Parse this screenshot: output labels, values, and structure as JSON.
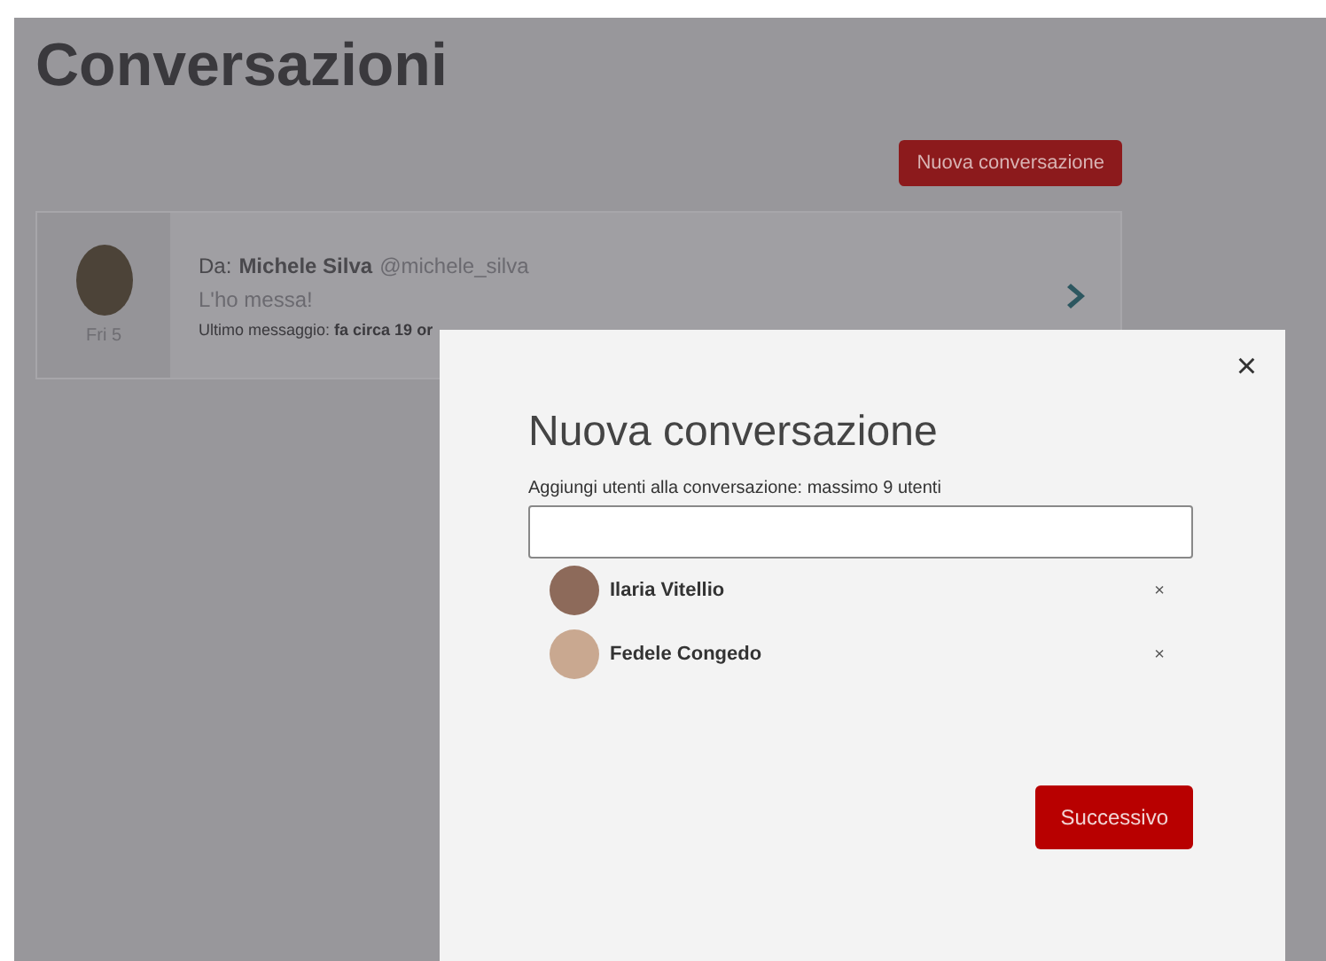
{
  "page": {
    "title": "Conversazioni",
    "new_button": "Nuova conversazione"
  },
  "conversations": [
    {
      "date": "Fri 5",
      "from_label": "Da:",
      "sender": "Michele Silva",
      "handle": "@michele_silva",
      "message": "L'ho messa!",
      "last": "Ultimo messaggio: **fa circa 19 or**"
    }
  ],
  "dialog": {
    "close": "×",
    "title": "Nuova conversazione",
    "label": "Aggiungi utenti alla conversazione: massimo 9 utenti",
    "users": [
      {
        "name": "Ilaria Vitellio",
        "remove": "×"
      },
      {
        "name": "Fedele Congedo",
        "remove": "×"
      }
    ],
    "next_button": "Successivo"
  }
}
